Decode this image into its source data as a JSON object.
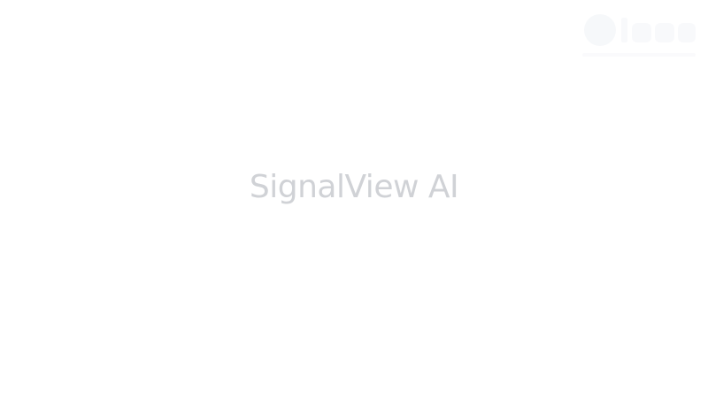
{
  "splash": {
    "title": "SignalView AI"
  },
  "watermark": {
    "icon": "brand-logo-icon"
  },
  "colors": {
    "background": "#ffffff",
    "title": "#d0d2d6",
    "watermark": "#e8ecf2"
  }
}
